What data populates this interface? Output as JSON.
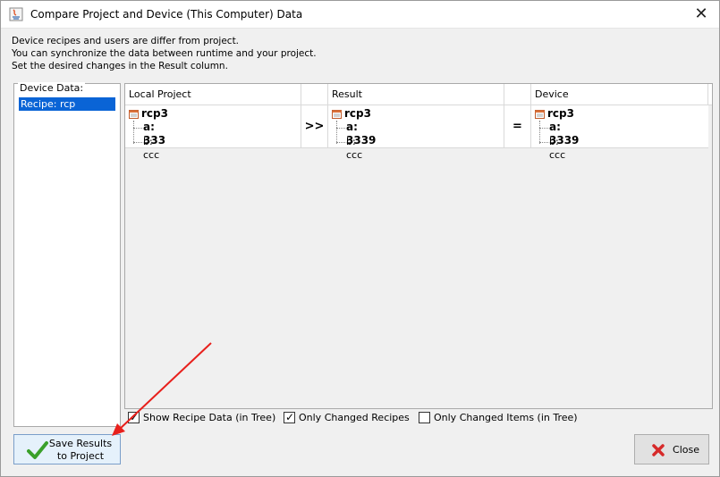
{
  "window": {
    "title": "Compare Project and Device (This Computer) Data",
    "close_symbol": "✕"
  },
  "info": {
    "line1": "Device recipes and users are differ from project.",
    "line2": "You can synchronize the data between runtime and your project.",
    "line3": "Set the desired changes in the Result column."
  },
  "left_panel": {
    "legend": "Device Data:",
    "items": [
      {
        "label": "Recipe: rcp",
        "selected": true
      }
    ]
  },
  "table": {
    "headers": {
      "local": "Local Project",
      "result": "Result",
      "device": "Device"
    },
    "row": {
      "local": {
        "name": "rcp3",
        "a": "a: 333",
        "b": "b: ccc"
      },
      "op1": ">>",
      "result": {
        "name": "rcp3",
        "a": "a: 3339",
        "b": "b: ccc"
      },
      "op2": "=",
      "device": {
        "name": "rcp3",
        "a": "a: 3339",
        "b": "b: ccc"
      }
    }
  },
  "options": {
    "show_recipe_tree": {
      "label": "Show Recipe Data (in Tree)",
      "checked": true
    },
    "only_changed_recipes": {
      "label": "Only Changed Recipes",
      "checked": true
    },
    "only_changed_items": {
      "label": "Only Changed Items (in Tree)",
      "checked": false
    }
  },
  "buttons": {
    "save_line1": "Save Results",
    "save_line2": "to Project",
    "close": "Close"
  },
  "icons": {
    "app": "java-app-icon",
    "save": "checkmark-icon",
    "close": "red-x-icon",
    "recipe": "recipe-icon"
  },
  "colors": {
    "selection": "#0a64d6",
    "arrow": "#e8201c",
    "check_green": "#3aa02a",
    "close_red": "#d62a2a"
  }
}
